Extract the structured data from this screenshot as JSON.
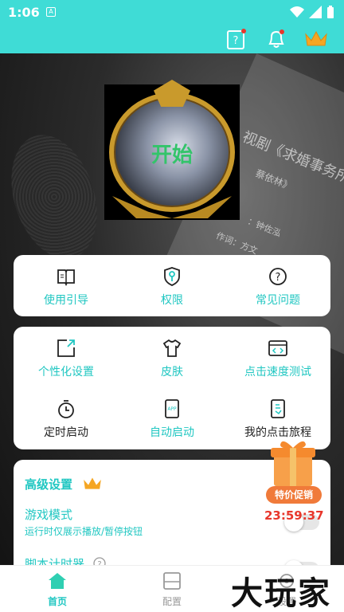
{
  "status_bar": {
    "time": "1:06",
    "a_badge": "A"
  },
  "header": {
    "icons": [
      "help-card-icon",
      "bell-icon",
      "crown-icon"
    ]
  },
  "hero": {
    "start_label": "开始",
    "lyric_lines": [
      "视剧《求婚事务所》",
      "蔡依林》",
      "：钟佐泓",
      "作词：方文"
    ]
  },
  "card_help": {
    "items": [
      {
        "label": "使用引导",
        "icon": "book-icon"
      },
      {
        "label": "权限",
        "icon": "shield-key-icon"
      },
      {
        "label": "常见问题",
        "icon": "question-icon"
      }
    ]
  },
  "card_features": {
    "items": [
      {
        "label": "个性化设置",
        "icon": "customize-icon"
      },
      {
        "label": "皮肤",
        "icon": "shirt-icon"
      },
      {
        "label": "点击速度测试",
        "icon": "code-window-icon"
      },
      {
        "label": "定时启动",
        "icon": "stopwatch-icon"
      },
      {
        "label": "自动启动",
        "icon": "app-icon"
      },
      {
        "label": "我的点击旅程",
        "icon": "journey-icon"
      }
    ]
  },
  "advanced": {
    "title": "高级设置",
    "game_mode": {
      "title": "游戏模式",
      "subtitle": "运行时仅展示播放/暂停按钮"
    },
    "script_timer": {
      "title": "脚本计时器"
    }
  },
  "promo": {
    "label": "特价促销",
    "timer": "23:59:37"
  },
  "bottom_nav": [
    {
      "label": "首页",
      "icon": "home-icon",
      "active": true
    },
    {
      "label": "配置",
      "icon": "config-icon",
      "active": false
    },
    {
      "label": "设置",
      "icon": "settings-icon",
      "active": false
    }
  ],
  "watermark": "大玩家",
  "colors": {
    "accent": "#21c7c2",
    "header": "#3fdcd6",
    "promo": "#f07a3a",
    "timer": "#e8372c"
  }
}
